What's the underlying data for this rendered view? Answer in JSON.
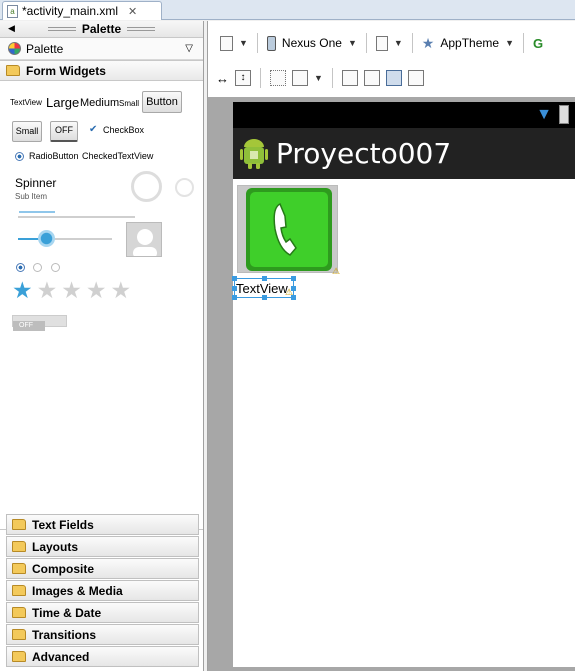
{
  "editor_tab": {
    "title": "*activity_main.xml",
    "close_glyph": "✕"
  },
  "palette": {
    "header_title": "Palette",
    "selector_label": "Palette",
    "open_section": "Form Widgets",
    "widgets": {
      "textview_small": "TextView",
      "large": "Large",
      "medium": "Medium",
      "small": "Small",
      "button": "Button",
      "small_button": "Small",
      "toggle": "OFF",
      "checkbox": "CheckBox",
      "radiobutton": "RadioButton",
      "checkedtextview": "CheckedTextView",
      "spinner_title": "Spinner",
      "spinner_sub": "Sub Item",
      "switch_off": "OFF"
    },
    "collapsed_sections": [
      "Text Fields",
      "Layouts",
      "Composite",
      "Images & Media",
      "Time & Date",
      "Transitions",
      "Advanced"
    ]
  },
  "toolbar": {
    "device": "Nexus One",
    "theme": "AppTheme"
  },
  "device_preview": {
    "app_title": "Proyecto007",
    "textview_label": "TextView"
  },
  "colors": {
    "selection": "#3b9be0",
    "phone_icon_green": "#3fcf2a",
    "actionbar": "#222222",
    "star_selected": "#3aa0d8"
  }
}
